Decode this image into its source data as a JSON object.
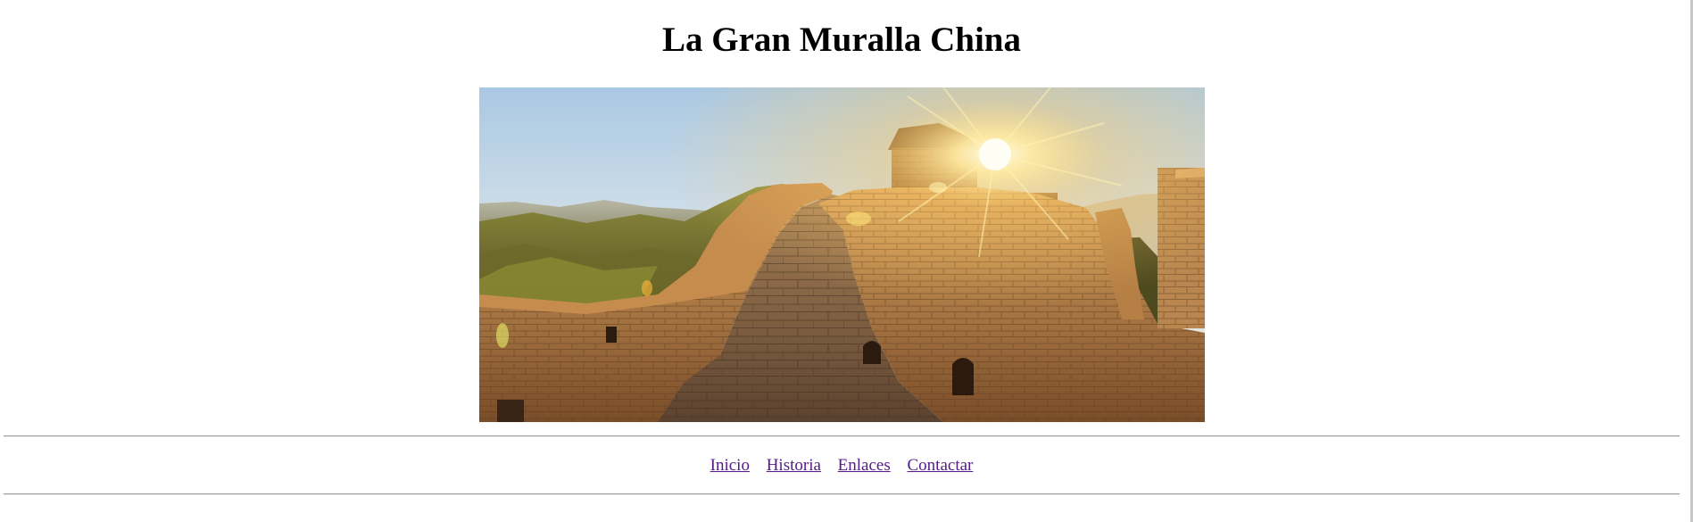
{
  "header": {
    "title": "La Gran Muralla China"
  },
  "hero_image": {
    "subject": "great-wall-sunset-photo"
  },
  "nav": {
    "links": [
      {
        "label": "Inicio"
      },
      {
        "label": "Historia"
      },
      {
        "label": "Enlaces"
      },
      {
        "label": "Contactar"
      }
    ],
    "link_color": "#551a8b"
  }
}
